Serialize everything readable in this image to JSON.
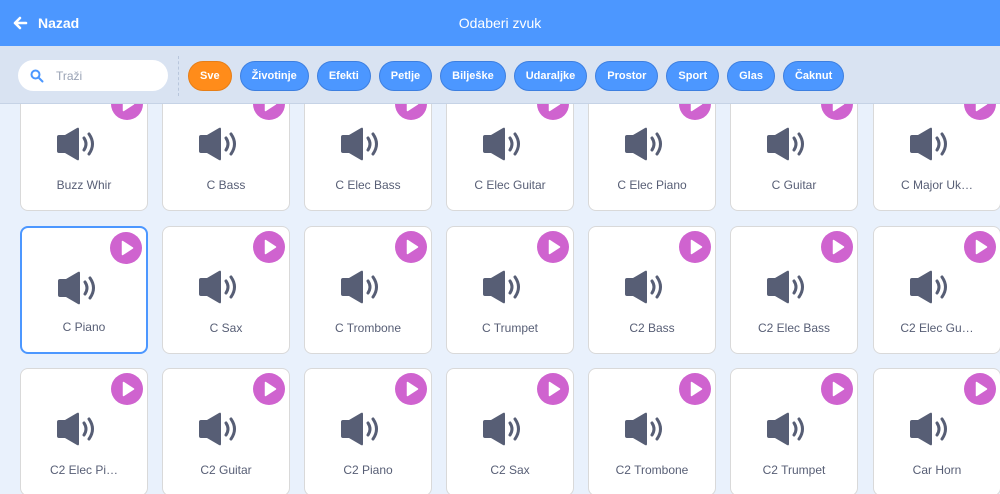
{
  "header": {
    "back_label": "Nazad",
    "title": "Odaberi zvuk"
  },
  "search": {
    "placeholder": "Traži"
  },
  "tags": [
    {
      "label": "Sve",
      "active": true
    },
    {
      "label": "Životinje"
    },
    {
      "label": "Efekti"
    },
    {
      "label": "Petlje"
    },
    {
      "label": "Bilješke"
    },
    {
      "label": "Udaraljke"
    },
    {
      "label": "Prostor"
    },
    {
      "label": "Sport"
    },
    {
      "label": "Glas"
    },
    {
      "label": "Čaknut"
    }
  ],
  "sounds": {
    "row1": [
      "Buzz Whir",
      "C Bass",
      "C Elec Bass",
      "C Elec Guitar",
      "C Elec Piano",
      "C Guitar",
      "C Major Uk…"
    ],
    "row2": [
      "C Piano",
      "C Sax",
      "C Trombone",
      "C Trumpet",
      "C2 Bass",
      "C2 Elec Bass",
      "C2 Elec Gu…"
    ],
    "row3": [
      "C2 Elec Pi…",
      "C2 Guitar",
      "C2 Piano",
      "C2 Sax",
      "C2 Trombone",
      "C2 Trumpet",
      "Car Horn"
    ]
  },
  "selected_sound": "C Piano",
  "colors": {
    "header": "#4c97ff",
    "active_tag": "#ff8c1a",
    "play_button": "#cf63cf",
    "speaker": "#575e75"
  }
}
